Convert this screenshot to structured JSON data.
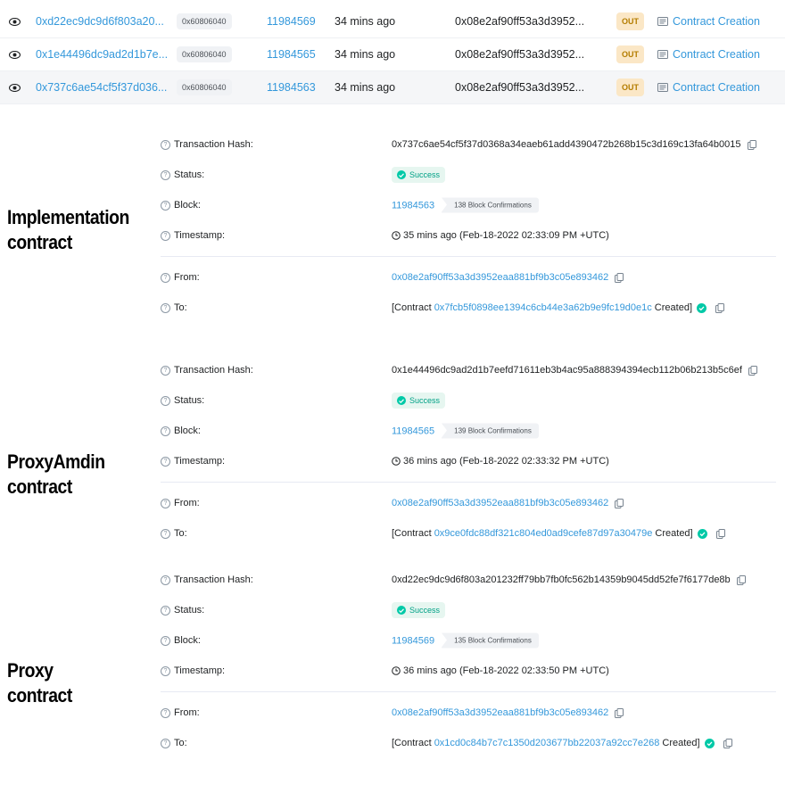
{
  "table": {
    "rows": [
      {
        "hash": "0xd22ec9dc9d6f803a20...",
        "method": "0x60806040",
        "block": "11984569",
        "age": "34 mins ago",
        "from": "0x08e2af90ff53a3d3952...",
        "direction": "OUT",
        "to": "Contract Creation",
        "highlighted": false
      },
      {
        "hash": "0x1e44496dc9ad2d1b7e...",
        "method": "0x60806040",
        "block": "11984565",
        "age": "34 mins ago",
        "from": "0x08e2af90ff53a3d3952...",
        "direction": "OUT",
        "to": "Contract Creation",
        "highlighted": false
      },
      {
        "hash": "0x737c6ae54cf5f37d036...",
        "method": "0x60806040",
        "block": "11984563",
        "age": "34 mins ago",
        "from": "0x08e2af90ff53a3d3952...",
        "direction": "OUT",
        "to": "Contract Creation",
        "highlighted": true
      }
    ]
  },
  "labels": {
    "tx_hash": "Transaction Hash:",
    "status": "Status:",
    "block": "Block:",
    "timestamp": "Timestamp:",
    "from": "From:",
    "to": "To:"
  },
  "sections": [
    {
      "side_label_line1": "Implementation",
      "side_label_line2": "contract",
      "tx_hash": "0x737c6ae54cf5f37d0368a34eaeb61add4390472b268b15c3d169c13fa64b0015",
      "status": "Success",
      "block": "11984563",
      "confirmations": "138 Block Confirmations",
      "timestamp": "35 mins ago (Feb-18-2022 02:33:09 PM +UTC)",
      "from": "0x08e2af90ff53a3d3952eaa881bf9b3c05e893462",
      "to_prefix": "[Contract ",
      "to_address": "0x7fcb5f0898ee1394c6cb44e3a62b9e9fc19d0e1c",
      "to_suffix": " Created]"
    },
    {
      "side_label_line1": "ProxyAmdin",
      "side_label_line2": "contract",
      "tx_hash": "0x1e44496dc9ad2d1b7eefd71611eb3b4ac95a888394394ecb112b06b213b5c6ef",
      "status": "Success",
      "block": "11984565",
      "confirmations": "139 Block Confirmations",
      "timestamp": "36 mins ago (Feb-18-2022 02:33:32 PM +UTC)",
      "from": "0x08e2af90ff53a3d3952eaa881bf9b3c05e893462",
      "to_prefix": "[Contract ",
      "to_address": "0x9ce0fdc88df321c804ed0ad9cefe87d97a30479e",
      "to_suffix": " Created]"
    },
    {
      "side_label_line1": "Proxy",
      "side_label_line2": "contract",
      "tx_hash": "0xd22ec9dc9d6f803a201232ff79bb7fb0fc562b14359b9045dd52fe7f6177de8b",
      "status": "Success",
      "block": "11984569",
      "confirmations": "135 Block Confirmations",
      "timestamp": "36 mins ago (Feb-18-2022 02:33:50 PM +UTC)",
      "from": "0x08e2af90ff53a3d3952eaa881bf9b3c05e893462",
      "to_prefix": "[Contract ",
      "to_address": "0x1cd0c84b7c7c1350d203677bb22037a92cc7e268",
      "to_suffix": " Created]"
    }
  ],
  "colors": {
    "link": "#3498db",
    "out_badge_bg": "#fbe7c6",
    "out_badge_text": "#b47d00",
    "success": "#00c9a7"
  }
}
